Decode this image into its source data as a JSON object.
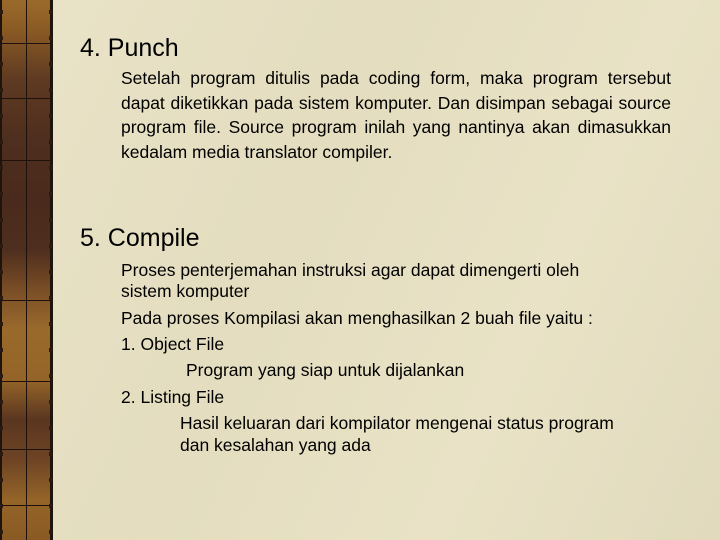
{
  "slide": {
    "background_color": "#e8e1c3",
    "stripe_color": "#8a5a24",
    "sections": [
      {
        "heading": "4. Punch",
        "paragraph": "Setelah program ditulis pada coding form, maka program tersebut dapat diketikkan pada sistem komputer. Dan disimpan sebagai source program file. Source program inilah yang nantinya akan dimasukkan kedalam media translator compiler."
      },
      {
        "heading": "5. Compile",
        "lines": [
          "Proses penterjemahan instruksi agar dapat dimengerti oleh",
          "sistem komputer",
          "Pada proses Kompilasi akan menghasilkan 2 buah file yaitu :",
          "1. Object File",
          "Program yang siap untuk dijalankan",
          "2. Listing File",
          "Hasil keluaran dari kompilator mengenai status program",
          "dan kesalahan yang ada"
        ]
      }
    ]
  }
}
